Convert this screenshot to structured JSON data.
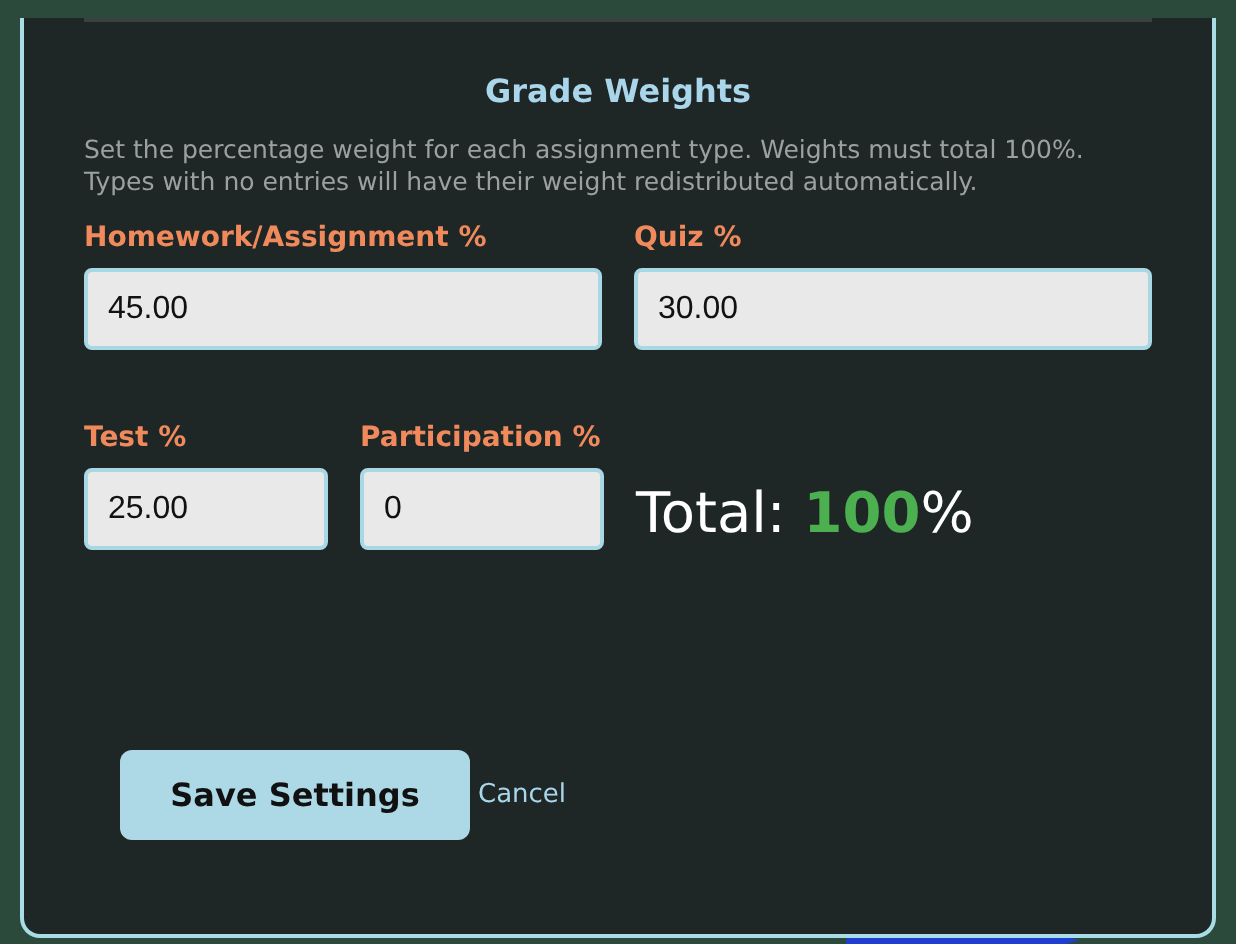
{
  "section": {
    "title": "Grade Weights",
    "description": "Set the percentage weight for each assignment type. Weights must total 100%. Types with no entries will have their weight redistributed automatically."
  },
  "rows": [
    {
      "fields": [
        {
          "label": "Homework/Assignment %",
          "value": "45.00"
        },
        {
          "label": "Quiz %",
          "value": "30.00"
        }
      ]
    },
    {
      "fields": [
        {
          "label": "Test %",
          "value": "25.00"
        },
        {
          "label": "Participation %",
          "value": "0"
        }
      ]
    }
  ],
  "total": {
    "label": "Total:",
    "value": "100",
    "unit": "%"
  },
  "buttons": {
    "save": "Save Settings",
    "cancel": "Cancel"
  }
}
